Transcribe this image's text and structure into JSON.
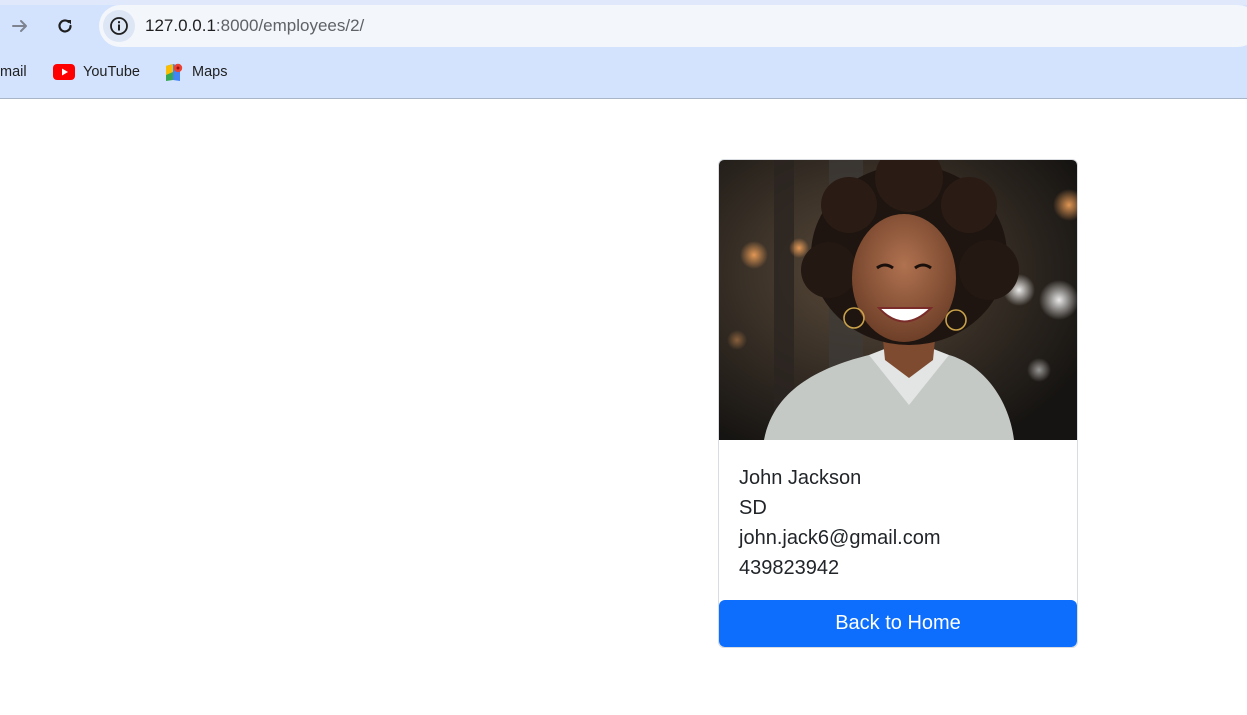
{
  "browser": {
    "url_host": "127.0.0.1",
    "url_rest": ":8000/employees/2/",
    "bookmarks": [
      {
        "label": "mail",
        "icon": "gmail-icon"
      },
      {
        "label": "YouTube",
        "icon": "youtube-icon"
      },
      {
        "label": "Maps",
        "icon": "maps-icon"
      }
    ]
  },
  "employee": {
    "photo": "employee-photo",
    "name": "John Jackson",
    "role": "SD",
    "email": "john.jack6@gmail.com",
    "phone": "439823942"
  },
  "actions": {
    "back_home_label": "Back to Home"
  },
  "colors": {
    "primary": "#0d6efd",
    "chrome": "#d3e3fd"
  }
}
